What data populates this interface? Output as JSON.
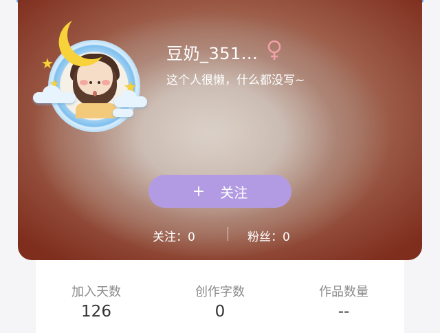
{
  "profile": {
    "username": "豆奶_351...",
    "bio": "这个人很懒，什么都没写~",
    "gender_icon": "female-icon",
    "gender_color": "#f2a0a8"
  },
  "actions": {
    "follow_plus": "+",
    "follow_label": "关注"
  },
  "social": {
    "following_label": "关注：",
    "following_count": "0",
    "followers_label": "粉丝：",
    "followers_count": "0"
  },
  "stats": [
    {
      "label": "加入天数",
      "value": "126"
    },
    {
      "label": "创作字数",
      "value": "0"
    },
    {
      "label": "作品数量",
      "value": "--"
    }
  ],
  "colors": {
    "accent_button": "#b39be3",
    "top_strip": "#5aa9f0"
  }
}
